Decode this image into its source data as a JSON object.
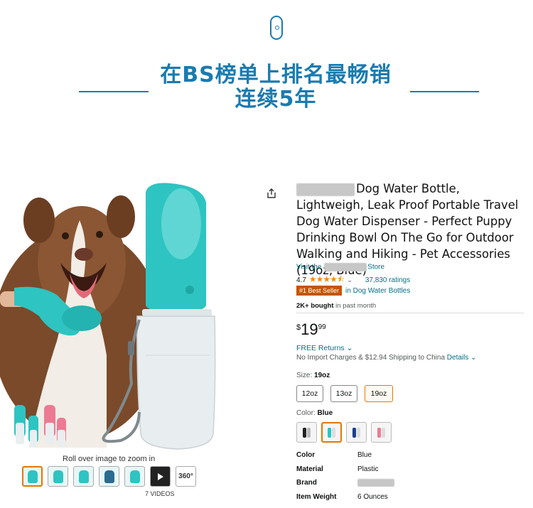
{
  "banner": {
    "line1": "在BS榜单上排名最畅销",
    "line2": "连续5年",
    "accent_color": "#1a7bb0"
  },
  "gallery": {
    "zoom_hint": "Roll over image to zoom in",
    "videos_label": "7 VIDEOS",
    "pano_label": "360°",
    "share_icon": "share-icon"
  },
  "product": {
    "title": "Dog Water Bottle, Lightweigh, Leak Proof Portable Travel Dog Water Dispenser - Perfect Puppy Drinking Bowl On The Go for Outdoor Walking and Hiking - Pet Accessories (19oz, Blue)",
    "visit_prefix": "Visit the",
    "visit_suffix": "Store",
    "rating_value": "4.7",
    "stars": "★★★★⯪",
    "rating_chevron": "⌄",
    "ratings_count": "37,830 ratings",
    "best_seller_badge": "#1 Best Seller",
    "best_seller_in": "in Dog Water Bottles",
    "bought_bold": "2K+ bought",
    "bought_rest": " in past month",
    "price_symbol": "$",
    "price_whole": "19",
    "price_fraction": "99",
    "free_returns": "FREE Returns ⌄",
    "shipping_text": "No Import Charges & $12.94 Shipping to China",
    "shipping_details": "Details ⌄",
    "size_label": "Size:",
    "size_selected": "19oz",
    "sizes": [
      "12oz",
      "13oz",
      "19oz"
    ],
    "color_label": "Color:",
    "color_selected": "Blue",
    "specs": [
      {
        "key": "Color",
        "value": "Blue"
      },
      {
        "key": "Material",
        "value": "Plastic"
      },
      {
        "key": "Brand",
        "value": ""
      },
      {
        "key": "Item Weight",
        "value": "6 Ounces"
      }
    ]
  }
}
